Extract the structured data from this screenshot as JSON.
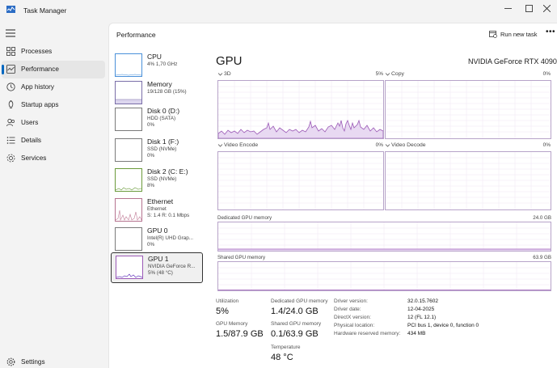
{
  "app": {
    "title": "Task Manager"
  },
  "nav": {
    "items": [
      {
        "label": "Processes",
        "icon": "grid-icon"
      },
      {
        "label": "Performance",
        "icon": "performance-icon"
      },
      {
        "label": "App history",
        "icon": "history-icon"
      },
      {
        "label": "Startup apps",
        "icon": "startup-icon"
      },
      {
        "label": "Users",
        "icon": "users-icon"
      },
      {
        "label": "Details",
        "icon": "details-icon"
      },
      {
        "label": "Services",
        "icon": "services-icon"
      }
    ],
    "settings_label": "Settings"
  },
  "header": {
    "title": "Performance",
    "run_task_label": "Run new task",
    "more_label": "•••"
  },
  "devices": [
    {
      "name": "CPU",
      "sub1": "4% 1,70 GHz",
      "sub2": ""
    },
    {
      "name": "Memory",
      "sub1": "19/128 GB (15%)",
      "sub2": ""
    },
    {
      "name": "Disk 0 (D:)",
      "sub1": "HDD (SATA)",
      "sub2": "0%"
    },
    {
      "name": "Disk 1 (F:)",
      "sub1": "SSD (NVMe)",
      "sub2": "0%"
    },
    {
      "name": "Disk 2 (C: E:)",
      "sub1": "SSD (NVMe)",
      "sub2": "8%"
    },
    {
      "name": "Ethernet",
      "sub1": "Ethernet",
      "sub2": "S: 1.4 R: 0.1 Mbps"
    },
    {
      "name": "GPU 0",
      "sub1": "Intel(R) UHD Grap...",
      "sub2": "0%"
    },
    {
      "name": "GPU 1",
      "sub1": "NVIDIA GeForce R...",
      "sub2": "5% (48 °C)"
    }
  ],
  "gpu": {
    "title": "GPU",
    "model": "NVIDIA GeForce RTX 4090",
    "engines": [
      {
        "label": "3D",
        "pct": "5%"
      },
      {
        "label": "Copy",
        "pct": "0%"
      },
      {
        "label": "Video Encode",
        "pct": "0%"
      },
      {
        "label": "Video Decode",
        "pct": "0%"
      }
    ],
    "dedicated_label": "Dedicated GPU memory",
    "dedicated_max": "24.0 GB",
    "shared_label": "Shared GPU memory",
    "shared_max": "63.9 GB",
    "stats": {
      "utilization_label": "Utilization",
      "utilization_value": "5%",
      "dedicated_label": "Dedicated GPU memory",
      "dedicated_value": "1.4/24.0 GB",
      "gpu_memory_label": "GPU Memory",
      "gpu_memory_value": "1.5/87.9 GB",
      "shared_label": "Shared GPU memory",
      "shared_value": "0.1/63.9 GB",
      "temperature_label": "Temperature",
      "temperature_value": "48 °C"
    },
    "driver": [
      {
        "key": "Driver version:",
        "value": "32.0.15.7602"
      },
      {
        "key": "Driver date:",
        "value": "12-04-2025"
      },
      {
        "key": "DirectX version:",
        "value": "12 (FL 12.1)"
      },
      {
        "key": "Physical location:",
        "value": "PCI bus 1, device 0, function 0"
      },
      {
        "key": "Hardware reserved memory:",
        "value": "434 MB"
      }
    ]
  },
  "colors": {
    "gpu": "#9b59b6",
    "gpu_fill": "#e8d9f2",
    "accent": "#0067c0"
  }
}
